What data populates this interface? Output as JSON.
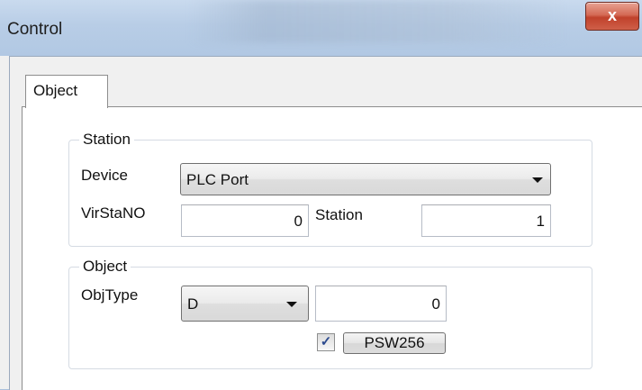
{
  "window": {
    "title": "Control",
    "close_symbol": "x"
  },
  "tabs": [
    {
      "label": "Object",
      "active": true
    }
  ],
  "station_group": {
    "title": "Station",
    "device_label": "Device",
    "device_value": "PLC Port",
    "virstano_label": "VirStaNO",
    "virstano_value": "0",
    "station_label": "Station",
    "station_value": "1"
  },
  "object_group": {
    "title": "Object",
    "objtype_label": "ObjType",
    "objtype_value": "D",
    "address_value": "0",
    "checkbox_checked": true,
    "checkbox_mark": "✓",
    "psw_button_label": "PSW256"
  },
  "icons": {
    "close": "close-icon",
    "dropdown": "chevron-down-icon",
    "check": "check-icon"
  },
  "colors": {
    "close_button": "#c7432d",
    "titlebar": "#b8cde6",
    "dialog_bg": "#f0f0f0"
  }
}
